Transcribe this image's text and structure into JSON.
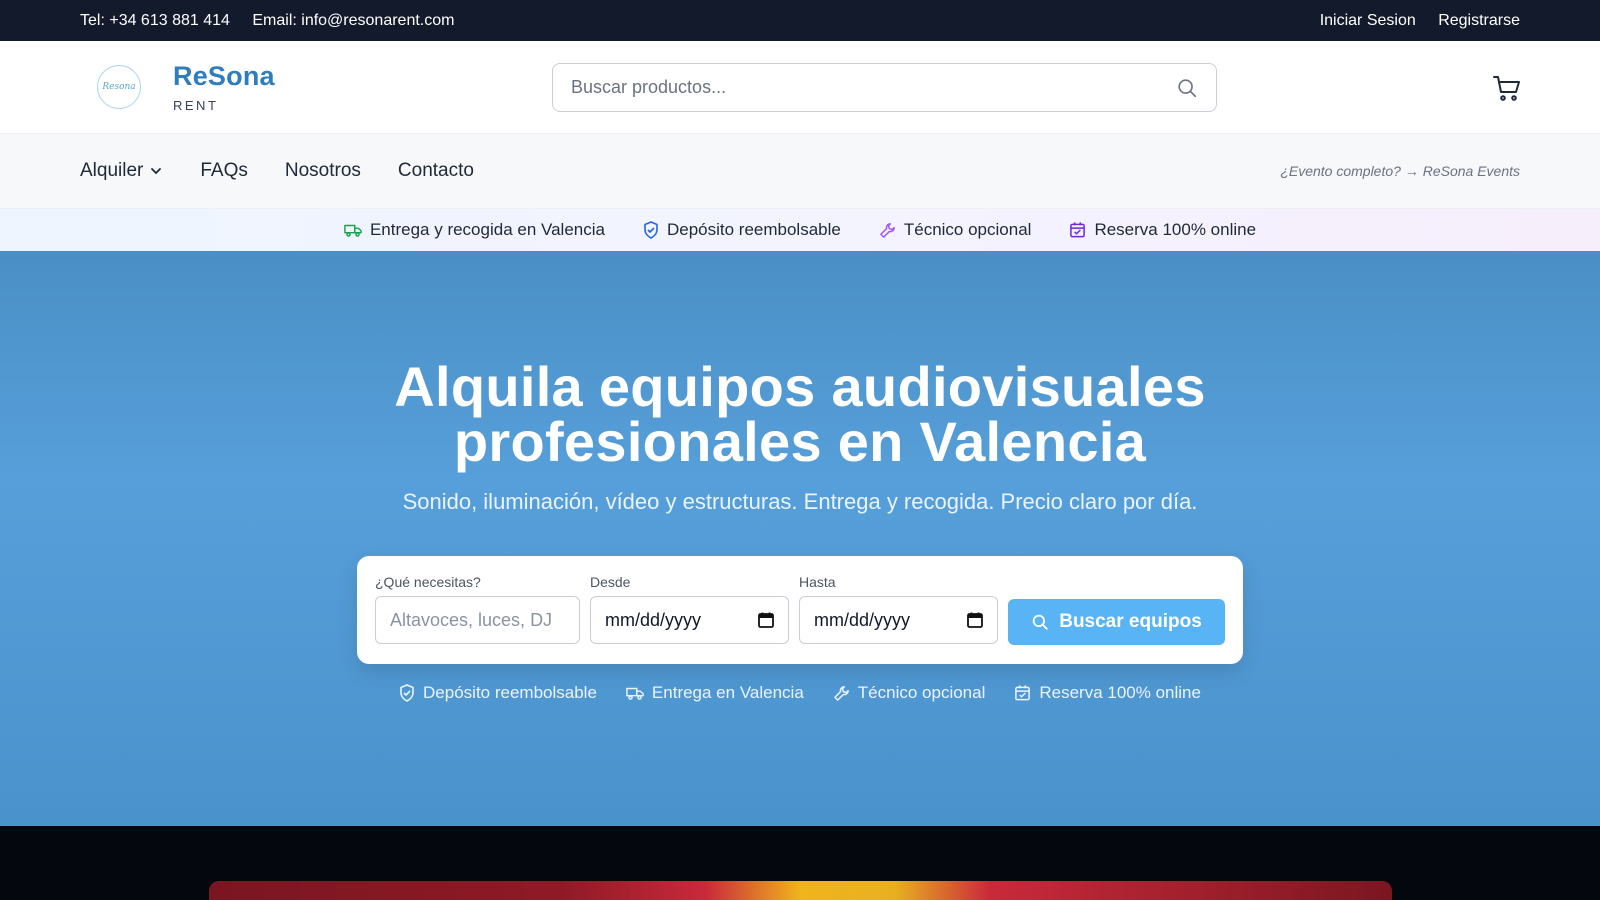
{
  "topbar": {
    "phone": "Tel: +34 613 881 414",
    "email": "Email: info@resonarent.com",
    "login": "Iniciar Sesion",
    "register": "Registrarse"
  },
  "header": {
    "logo_text": "Resona",
    "brand_name": "ReSona",
    "brand_sub": "RENT",
    "search_placeholder": "Buscar productos..."
  },
  "nav": {
    "items": [
      "Alquiler",
      "FAQs",
      "Nosotros",
      "Contacto"
    ],
    "promo": "¿Evento completo? → ReSona Events"
  },
  "features": [
    {
      "icon": "truck-icon",
      "label": "Entrega y recogida en Valencia",
      "color": "#16a34a"
    },
    {
      "icon": "shield-icon",
      "label": "Depósito reembolsable",
      "color": "#2563eb"
    },
    {
      "icon": "wrench-icon",
      "label": "Técnico opcional",
      "color": "#a855f7"
    },
    {
      "icon": "calendar-icon",
      "label": "Reserva 100% online",
      "color": "#6d28d9"
    }
  ],
  "hero": {
    "title_line1": "Alquila equipos audiovisuales",
    "title_line2": "profesionales en Valencia",
    "subtitle": "Sonido, iluminación, vídeo y estructuras. Entrega y recogida. Precio claro por día.",
    "form": {
      "what_label": "¿Qué necesitas?",
      "what_placeholder": "Altavoces, luces, DJ",
      "from_label": "Desde",
      "from_value": "mm/dd/yyyy",
      "to_label": "Hasta",
      "to_value": "mm/dd/yyyy",
      "button_label": "Buscar equipos"
    },
    "perks": [
      {
        "icon": "shield-icon",
        "label": "Depósito reembolsable"
      },
      {
        "icon": "truck-icon",
        "label": "Entrega en Valencia"
      },
      {
        "icon": "wrench-icon",
        "label": "Técnico opcional"
      },
      {
        "icon": "calendar-icon",
        "label": "Reserva 100% online"
      }
    ]
  },
  "colors": {
    "topbar_bg": "#121a2c",
    "brand": "#2f7dbd",
    "hero_bg": "#579fda",
    "button": "#58b4f4"
  }
}
